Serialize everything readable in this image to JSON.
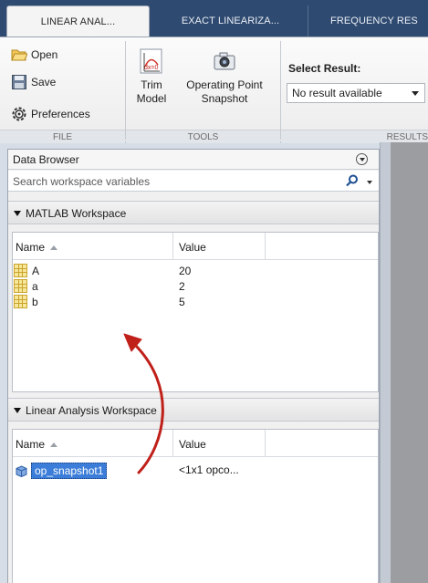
{
  "tabs": [
    {
      "label": "LINEAR ANAL..."
    },
    {
      "label": "EXACT LINEARIZA..."
    },
    {
      "label": "FREQUENCY RES"
    }
  ],
  "ribbon": {
    "file": {
      "open_label": "Open",
      "save_label": "Save",
      "preferences_label": "Preferences",
      "section_label": "FILE"
    },
    "tools": {
      "trim_model_label_1": "Trim",
      "trim_model_label_2": "Model",
      "trim_icon_text": "dx=0",
      "snapshot_label_1": "Operating Point",
      "snapshot_label_2": "Snapshot",
      "section_label": "TOOLS"
    },
    "results": {
      "select_label": "Select Result:",
      "select_value": "No result available",
      "section_label": "RESULTS"
    }
  },
  "data_browser": {
    "title": "Data Browser",
    "search_placeholder": "Search workspace variables",
    "matlab_workspace": {
      "title": "MATLAB Workspace",
      "col_name": "Name",
      "col_value": "Value",
      "rows": [
        {
          "name": "A",
          "value": "20"
        },
        {
          "name": "a",
          "value": "2"
        },
        {
          "name": "b",
          "value": "5"
        }
      ]
    },
    "linear_workspace": {
      "title": "Linear Analysis Workspace",
      "col_name": "Name",
      "col_value": "Value",
      "rows": [
        {
          "name": "op_snapshot1",
          "value": "<1x1 opco..."
        }
      ]
    }
  },
  "colors": {
    "tab_strip": "#2f4a70",
    "selection": "#3b7dd8",
    "arrow": "#c0201a"
  }
}
